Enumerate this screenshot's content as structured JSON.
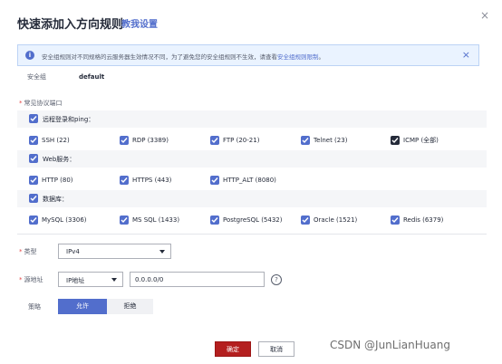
{
  "dialog": {
    "title": "快速添加入方向规则",
    "help_link": "教我设置",
    "close_glyph": "×"
  },
  "notice": {
    "text": "安全组规则对不同规格的云服务器生效情况不同，为了避免您的安全组规则不生效，请查看",
    "link": "安全组规则限制",
    "tail": "。",
    "close_glyph": "×"
  },
  "security_group": {
    "label": "安全组",
    "value": "default"
  },
  "ports": {
    "label": "常见协议端口",
    "groups": [
      {
        "label": "远程登录和ping：",
        "options": [
          "SSH (22)",
          "RDP (3389)",
          "FTP (20-21)",
          "Telnet (23)",
          "ICMP (全部)"
        ]
      },
      {
        "label": "Web服务：",
        "options": [
          "HTTP (80)",
          "HTTPS (443)",
          "HTTP_ALT (8080)"
        ]
      },
      {
        "label": "数据库：",
        "options": [
          "MySQL (3306)",
          "MS SQL (1433)",
          "PostgreSQL (5432)",
          "Oracle (1521)",
          "Redis (6379)"
        ]
      }
    ]
  },
  "type": {
    "label": "类型",
    "value": "IPv4"
  },
  "source": {
    "label": "源地址",
    "select_value": "IP地址",
    "input_value": "0.0.0.0/0",
    "help": "?"
  },
  "policy": {
    "label": "策略",
    "allow": "允许",
    "deny": "拒绝"
  },
  "footer": {
    "ok": "确定",
    "cancel": "取消"
  },
  "watermark": "CSDN @JunLianHuang",
  "colors": {
    "accent": "#526ecc",
    "primary_button": "#b41f1f",
    "required": "#e54545"
  }
}
